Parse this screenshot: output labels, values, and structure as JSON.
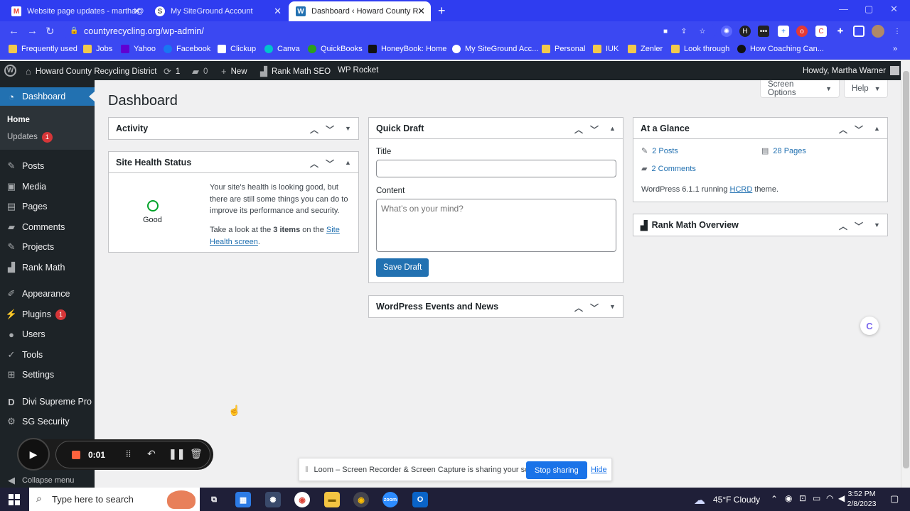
{
  "browser": {
    "tabs": [
      {
        "title": "Website page updates - martha@",
        "icon": "gmail-icon"
      },
      {
        "title": "My SiteGround Account",
        "icon": "siteground-icon"
      },
      {
        "title": "Dashboard ‹ Howard County Rec",
        "icon": "wordpress-icon"
      }
    ],
    "url": "countyrecycling.org/wp-admin/",
    "bookmarks": [
      "Frequently used",
      "Jobs",
      "Yahoo",
      "Facebook",
      "Clickup",
      "Canva",
      "QuickBooks",
      "HoneyBook: Home",
      "My SiteGround Acc...",
      "Personal",
      "IUK",
      "Zenler",
      "Look through",
      "How Coaching Can..."
    ]
  },
  "adminbar": {
    "site_name": "Howard County Recycling District",
    "updates_count": "1",
    "comments_count": "0",
    "new_label": "New",
    "rankmath_label": "Rank Math SEO",
    "wprocket_label": "WP Rocket",
    "howdy": "Howdy, Martha Warner"
  },
  "sidebar": {
    "dashboard": "Dashboard",
    "home": "Home",
    "updates": "Updates",
    "updates_badge": "1",
    "items": [
      "Posts",
      "Media",
      "Pages",
      "Comments",
      "Projects",
      "Rank Math",
      "Appearance",
      "Plugins",
      "Users",
      "Tools",
      "Settings",
      "Divi Supreme Pro",
      "SG Security"
    ],
    "plugins_badge": "1",
    "collapse": "Collapse menu"
  },
  "main": {
    "title": "Dashboard",
    "screen_options": "Screen Options",
    "help": "Help",
    "activity": "Activity",
    "site_health": {
      "title": "Site Health Status",
      "status": "Good",
      "text1": "Your site's health is looking good, but there are still some things you can do to improve its performance and security.",
      "text2_prefix": "Take a look at the ",
      "text2_bold": "3 items",
      "text2_mid": " on the ",
      "text2_link": "Site Health screen",
      "text2_end": "."
    },
    "quick_draft": {
      "title": "Quick Draft",
      "title_label": "Title",
      "content_label": "Content",
      "content_placeholder": "What’s on your mind?",
      "save": "Save Draft"
    },
    "events": "WordPress Events and News",
    "glance": {
      "title": "At a Glance",
      "posts": "2 Posts",
      "pages": "28 Pages",
      "comments": "2 Comments",
      "running_prefix": "WordPress 6.1.1 running ",
      "theme": "HCRD",
      "running_suffix": " theme."
    },
    "rankmath_overview": "Rank Math Overview"
  },
  "loom": {
    "timer": "0:01",
    "share_text": "Loom – Screen Recorder & Screen Capture is sharing your screen.",
    "stop": "Stop sharing",
    "hide": "Hide"
  },
  "taskbar": {
    "search_placeholder": "Type here to search",
    "weather": "45°F  Cloudy",
    "time": "3:52 PM",
    "date": "2/8/2023"
  },
  "colors": {
    "admin_dark": "#1d2327",
    "wp_blue": "#2271b1",
    "chrome_blue": "#2f3df0",
    "badge_red": "#d63638"
  }
}
